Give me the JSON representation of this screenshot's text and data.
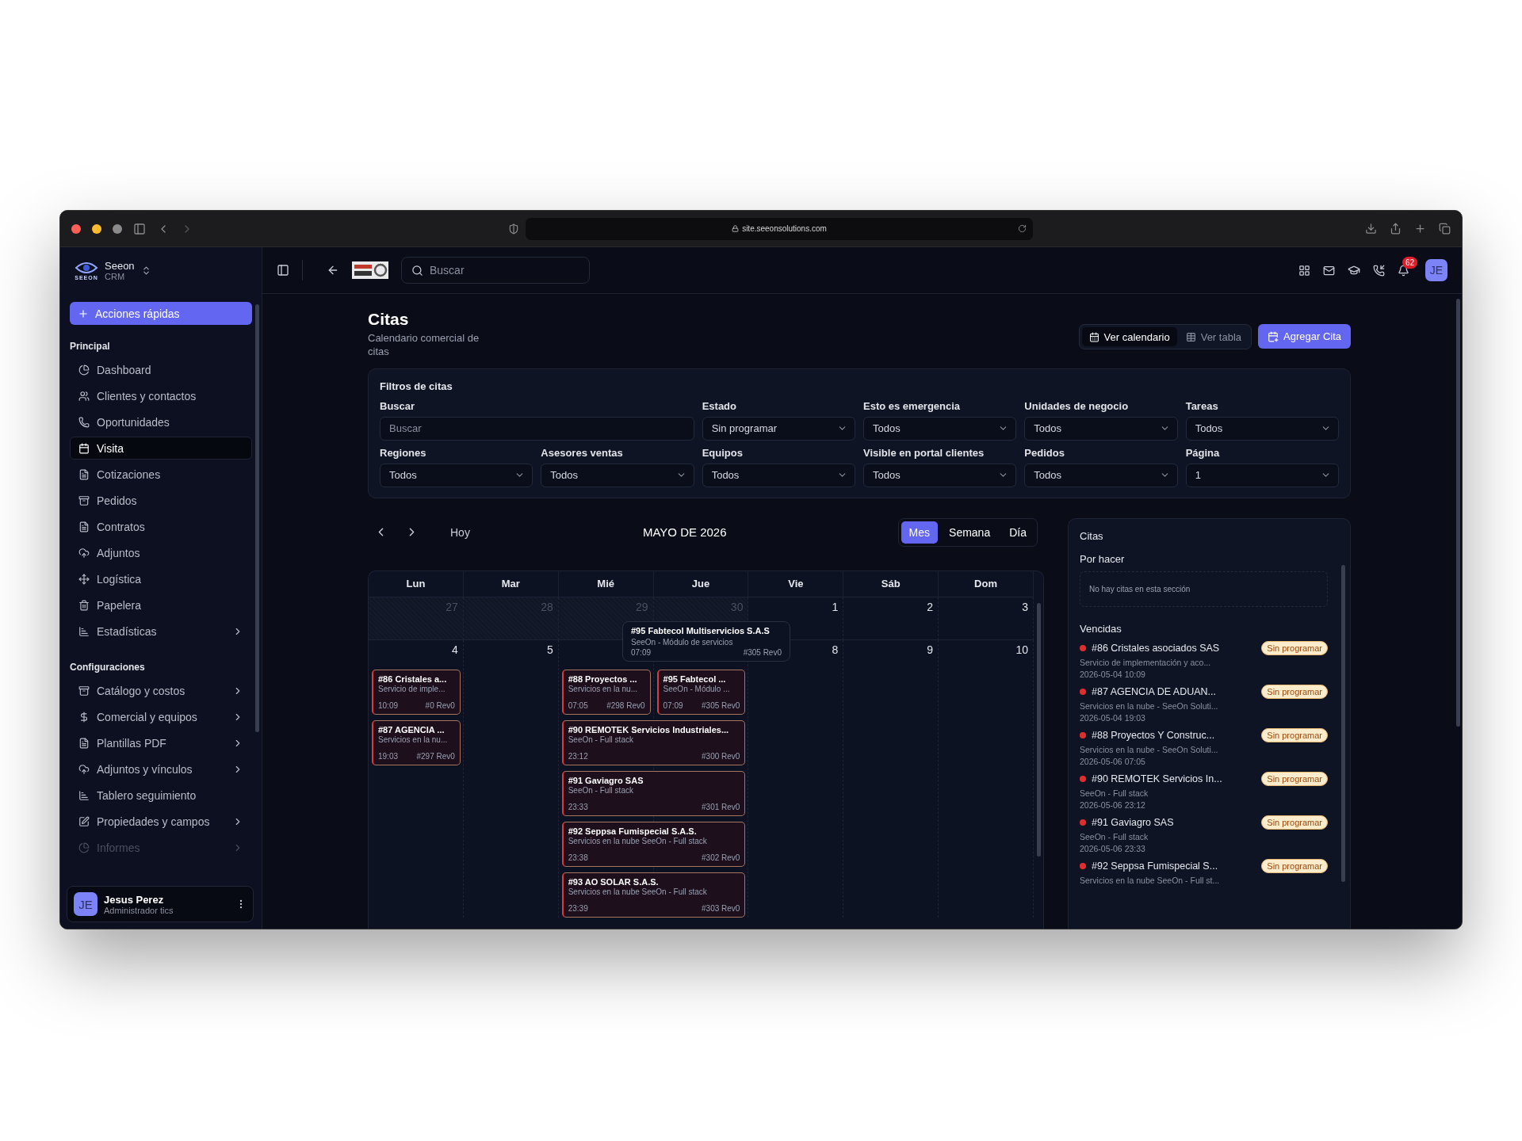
{
  "browser": {
    "url": "site.seeonsolutions.com"
  },
  "sidebar": {
    "brand": {
      "logo_text": "SEEON",
      "name": "Seeon",
      "sub": "CRM"
    },
    "quick_action": "Acciones rápidas",
    "sections": [
      {
        "title": "Principal",
        "items": [
          {
            "label": "Dashboard",
            "selected": false,
            "expandable": false,
            "faded": false
          },
          {
            "label": "Clientes y contactos",
            "selected": false,
            "expandable": false,
            "faded": false
          },
          {
            "label": "Oportunidades",
            "selected": false,
            "expandable": false,
            "faded": false
          },
          {
            "label": "Visita",
            "selected": true,
            "expandable": false,
            "faded": false
          },
          {
            "label": "Cotizaciones",
            "selected": false,
            "expandable": false,
            "faded": false
          },
          {
            "label": "Pedidos",
            "selected": false,
            "expandable": false,
            "faded": false
          },
          {
            "label": "Contratos",
            "selected": false,
            "expandable": false,
            "faded": false
          },
          {
            "label": "Adjuntos",
            "selected": false,
            "expandable": false,
            "faded": false
          },
          {
            "label": "Logística",
            "selected": false,
            "expandable": false,
            "faded": false
          },
          {
            "label": "Papelera",
            "selected": false,
            "expandable": false,
            "faded": false
          },
          {
            "label": "Estadísticas",
            "selected": false,
            "expandable": true,
            "faded": false
          }
        ]
      },
      {
        "title": "Configuraciones",
        "items": [
          {
            "label": "Catálogo y costos",
            "selected": false,
            "expandable": true,
            "faded": false
          },
          {
            "label": "Comercial y equipos",
            "selected": false,
            "expandable": true,
            "faded": false
          },
          {
            "label": "Plantillas PDF",
            "selected": false,
            "expandable": true,
            "faded": false
          },
          {
            "label": "Adjuntos y vínculos",
            "selected": false,
            "expandable": true,
            "faded": false
          },
          {
            "label": "Tablero seguimiento",
            "selected": false,
            "expandable": false,
            "faded": false
          },
          {
            "label": "Propiedades y campos",
            "selected": false,
            "expandable": true,
            "faded": false
          },
          {
            "label": "Informes",
            "selected": false,
            "expandable": true,
            "faded": true
          }
        ]
      }
    ],
    "user": {
      "initials": "JE",
      "name": "Jesus Perez",
      "role": "Administrador tics"
    }
  },
  "topbar": {
    "search_placeholder": "Buscar",
    "notifications": "62",
    "avatar": "JE"
  },
  "header": {
    "title": "Citas",
    "subtitle": "Calendario comercial de citas",
    "view_toggle": [
      {
        "label": "Ver calendario",
        "selected": true
      },
      {
        "label": "Ver tabla",
        "selected": false
      }
    ],
    "add_button": "Agregar Cita"
  },
  "filters": {
    "title": "Filtros de citas",
    "fields": [
      {
        "kind": "text",
        "label": "Buscar",
        "placeholder": "Buscar"
      },
      {
        "kind": "select",
        "label": "Estado",
        "value": "Sin programar"
      },
      {
        "kind": "select",
        "label": "Esto es emergencia",
        "value": "Todos"
      },
      {
        "kind": "select",
        "label": "Unidades de negocio",
        "value": "Todos"
      },
      {
        "kind": "select",
        "label": "Tareas",
        "value": "Todos"
      },
      {
        "kind": "select",
        "label": "Regiones",
        "value": "Todos"
      },
      {
        "kind": "select",
        "label": "Asesores ventas",
        "value": "Todos"
      },
      {
        "kind": "select",
        "label": "Equipos",
        "value": "Todos"
      },
      {
        "kind": "select",
        "label": "Visible en portal clientes",
        "value": "Todos"
      },
      {
        "kind": "select",
        "label": "Pedidos",
        "value": "Todos"
      },
      {
        "kind": "select",
        "label": "Página",
        "value": "1"
      }
    ]
  },
  "calendar": {
    "today": "Hoy",
    "title": "MAYO DE 2026",
    "views": [
      {
        "label": "Mes",
        "selected": true
      },
      {
        "label": "Semana",
        "selected": false
      },
      {
        "label": "Día",
        "selected": false
      }
    ],
    "weekdays": [
      "Lun",
      "Mar",
      "Mié",
      "Jue",
      "Vie",
      "Sáb",
      "Dom"
    ],
    "weeks": [
      {
        "days": [
          {
            "number": "27",
            "outside": true
          },
          {
            "number": "28",
            "outside": true
          },
          {
            "number": "29",
            "outside": true
          },
          {
            "number": "30",
            "outside": true
          },
          {
            "number": "1",
            "outside": false
          },
          {
            "number": "2",
            "outside": false
          },
          {
            "number": "3",
            "outside": false
          }
        ]
      },
      {
        "days": [
          {
            "number": "4",
            "events": [
              {
                "kind": "single",
                "title": "#86 Cristales a...",
                "desc": "Servicio de imple...",
                "time": "10:09",
                "ref": "#0 Rev0"
              },
              {
                "kind": "single",
                "title": "#87 AGENCIA ...",
                "desc": "Servicios en la nu...",
                "time": "19:03",
                "ref": "#297 Rev0"
              }
            ]
          },
          {
            "number": "5"
          },
          {
            "events": [
              {
                "kind": "single",
                "title": "#88 Proyectos ...",
                "desc": "Servicios en la nu...",
                "time": "07:05",
                "ref": "#298 Rev0"
              },
              {
                "kind": "spans_next",
                "title": "#90 REMOTEK Servicios Industriales...",
                "desc": "SeeOn - Full stack",
                "time": "23:12",
                "ref": "#300 Rev0"
              },
              {
                "kind": "spans_next",
                "title": "#91 Gaviagro SAS",
                "desc": "SeeOn - Full stack",
                "time": "23:33",
                "ref": "#301 Rev0"
              },
              {
                "kind": "spans_next",
                "title": "#92 Seppsa Fumispecial S.A.S.",
                "desc": "Servicios en la nube SeeOn - Full stack",
                "time": "23:38",
                "ref": "#302 Rev0"
              },
              {
                "kind": "spans_next",
                "title": "#93 AO SOLAR S.A.S.",
                "desc": "Servicios en la nube SeeOn - Full stack",
                "time": "23:39",
                "ref": "#303 Rev0"
              }
            ]
          },
          {
            "events": [
              {
                "kind": "single",
                "title": "#95 Fabtecol ...",
                "desc": "SeeOn - Módulo ...",
                "time": "07:09",
                "ref": "#305 Rev0"
              }
            ]
          },
          {
            "number": "8"
          },
          {
            "number": "9"
          },
          {
            "number": "10"
          }
        ]
      }
    ],
    "tooltip": {
      "title": "#95 Fabtecol Multiservicios S.A.S",
      "desc": "SeeOn - Módulo de servicios",
      "time": "07:09",
      "ref": "#305 Rev0"
    }
  },
  "agenda": {
    "title": "Citas",
    "sections": [
      {
        "title": "Por hacer",
        "empty_text": "No hay citas en esta sección"
      },
      {
        "title": "Vencidas",
        "items": [
          {
            "title": "#86 Cristales asociados SAS",
            "status": "Sin programar",
            "desc": "Servicio de implementación y aco...",
            "date": "2026-05-04 10:09"
          },
          {
            "title": "#87 AGENCIA DE ADUAN...",
            "status": "Sin programar",
            "desc": "Servicios en la nube - SeeOn Soluti...",
            "date": "2026-05-04 19:03"
          },
          {
            "title": "#88 Proyectos Y Construc...",
            "status": "Sin programar",
            "desc": "Servicios en la nube - SeeOn Soluti...",
            "date": "2026-05-06 07:05"
          },
          {
            "title": "#90 REMOTEK Servicios In...",
            "status": "Sin programar",
            "desc": "SeeOn - Full stack",
            "date": "2026-05-06 23:12"
          },
          {
            "title": "#91 Gaviagro SAS",
            "status": "Sin programar",
            "desc": "SeeOn - Full stack",
            "date": "2026-05-06 23:33"
          },
          {
            "title": "#92 Seppsa Fumispecial S...",
            "status": "Sin programar",
            "desc": "Servicios en la nube SeeOn - Full st..."
          }
        ]
      }
    ]
  }
}
